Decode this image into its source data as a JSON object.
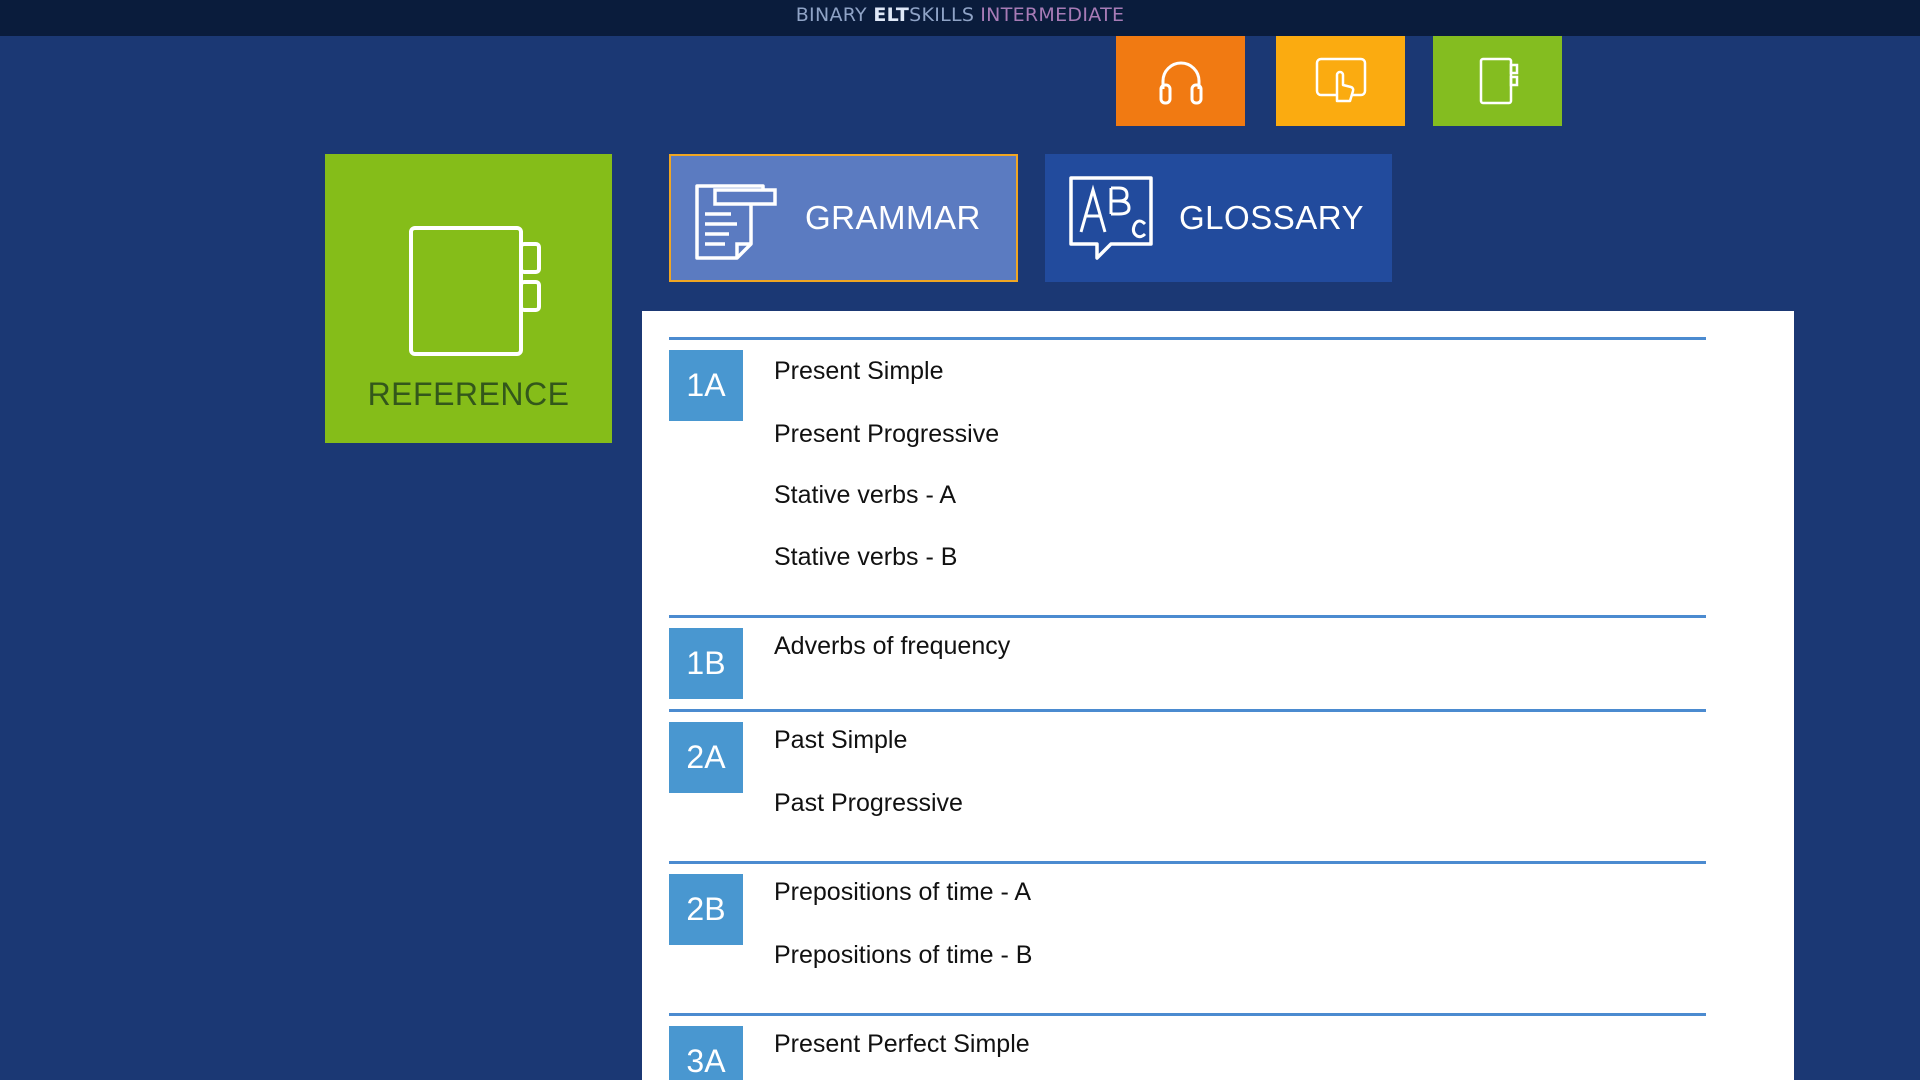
{
  "brand": {
    "part1": "BINARY ",
    "part2": "ELT",
    "part3": "SKILLS",
    "part4": "INTERMEDIATE"
  },
  "mode_tiles": [
    {
      "name": "headphones-icon",
      "color": "#f17a12"
    },
    {
      "name": "touch-hand-icon",
      "color": "#fbab10"
    },
    {
      "name": "notebook-icon",
      "color": "#84bd20"
    }
  ],
  "reference": {
    "label": "REFERENCE",
    "color": "#85bd19"
  },
  "tabs": {
    "grammar": {
      "label": "GRAMMAR",
      "active": true
    },
    "glossary": {
      "label": "GLOSSARY",
      "active": false
    }
  },
  "sections": [
    {
      "unit": "1A",
      "topics": [
        "Present Simple",
        "Present Progressive",
        "Stative verbs - A",
        "Stative verbs - B"
      ]
    },
    {
      "unit": "1B",
      "topics": [
        "Adverbs of frequency"
      ]
    },
    {
      "unit": "2A",
      "topics": [
        "Past Simple",
        "Past Progressive"
      ]
    },
    {
      "unit": "2B",
      "topics": [
        "Prepositions of time - A",
        "Prepositions of time - B"
      ]
    },
    {
      "unit": "3A",
      "topics": [
        "Present Perfect Simple"
      ]
    }
  ],
  "colors": {
    "background": "#1b3874",
    "accent_border": "#f0a623",
    "unit_badge": "#4997d0",
    "divider": "#4b8bd0"
  }
}
